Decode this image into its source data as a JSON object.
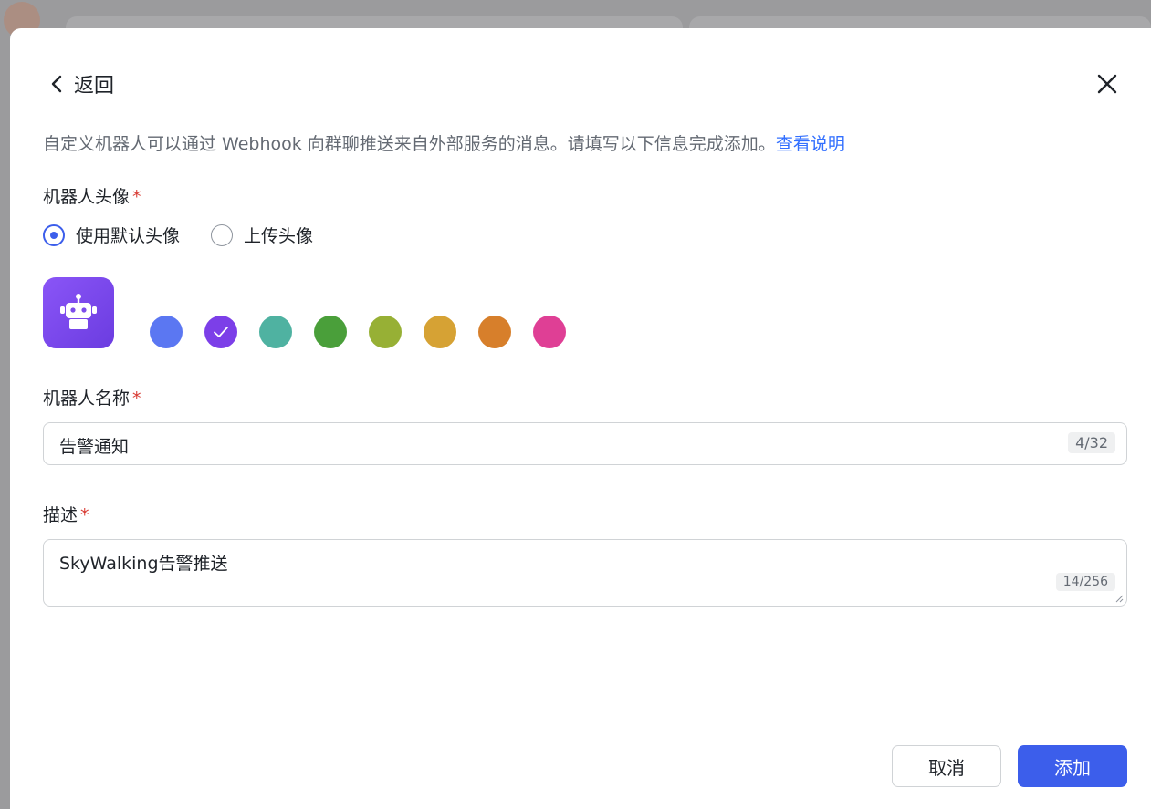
{
  "header": {
    "back_label": "返回"
  },
  "intro": {
    "text": "自定义机器人可以通过 Webhook 向群聊推送来自外部服务的消息。请填写以下信息完成添加。",
    "link_label": "查看说明"
  },
  "avatar_section": {
    "label": "机器人头像",
    "required_mark": "*",
    "options": [
      {
        "label": "使用默认头像",
        "selected": true
      },
      {
        "label": "上传头像",
        "selected": false
      }
    ],
    "avatar_color": "#7c4dea",
    "colors": [
      {
        "hex": "#5b77f2",
        "selected": false
      },
      {
        "hex": "#7c3fe8",
        "selected": true
      },
      {
        "hex": "#4fb2a1",
        "selected": false
      },
      {
        "hex": "#4a9f3a",
        "selected": false
      },
      {
        "hex": "#97b035",
        "selected": false
      },
      {
        "hex": "#d6a234",
        "selected": false
      },
      {
        "hex": "#d77f2b",
        "selected": false
      },
      {
        "hex": "#df3f95",
        "selected": false
      }
    ]
  },
  "name_field": {
    "label": "机器人名称",
    "required_mark": "*",
    "value": "告警通知",
    "counter": "4/32"
  },
  "desc_field": {
    "label": "描述",
    "required_mark": "*",
    "value": "SkyWalking告警推送",
    "counter": "14/256"
  },
  "footer": {
    "cancel_label": "取消",
    "add_label": "添加"
  },
  "theme": {
    "primary": "#3c5eeb",
    "link": "#3370ff",
    "required": "#d83931"
  }
}
